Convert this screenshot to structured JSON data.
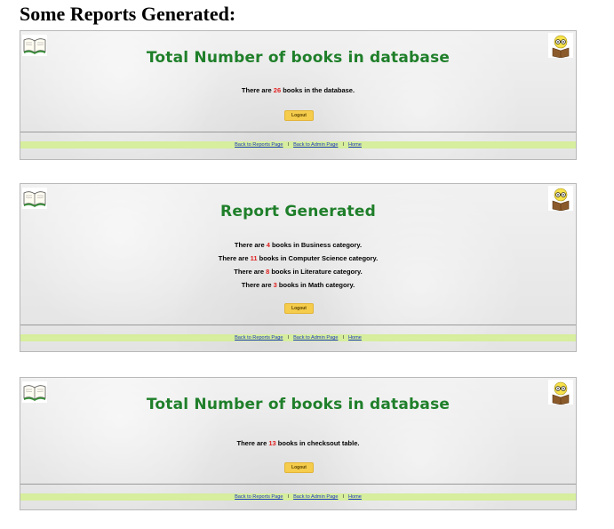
{
  "page_heading": "Some Reports Generated:",
  "reports": [
    {
      "title": "Total Number of books in database",
      "messages": [
        {
          "pre": "There are ",
          "num": "26",
          "post": " books in the database."
        }
      ],
      "logout_label": "Logout"
    },
    {
      "title": "Report Generated",
      "messages": [
        {
          "pre": "There are ",
          "num": "4",
          "post": " books in Business category."
        },
        {
          "pre": "There are ",
          "num": "11",
          "post": " books in Computer Science category."
        },
        {
          "pre": "There are ",
          "num": "8",
          "post": " books in Literature category."
        },
        {
          "pre": "There are ",
          "num": "3",
          "post": " books in Math category."
        }
      ],
      "logout_label": "Logout"
    },
    {
      "title": "Total Number of books in database",
      "messages": [
        {
          "pre": "There are ",
          "num": "13",
          "post": " books in checksout table."
        }
      ],
      "logout_label": "Logout"
    }
  ],
  "footer": {
    "link_reports": "Back to Reports Page",
    "link_admin": "Back to Admin Page",
    "link_home": "Home",
    "separator": "I"
  },
  "colors": {
    "title_green": "#1f7f2a",
    "count_red": "#e02020",
    "footer_bar": "#d6ee9d",
    "logout_button": "#f5cc4c",
    "link_blue": "#1a35c0"
  },
  "icons": [
    "open-book-icon",
    "reading-owl-icon"
  ]
}
